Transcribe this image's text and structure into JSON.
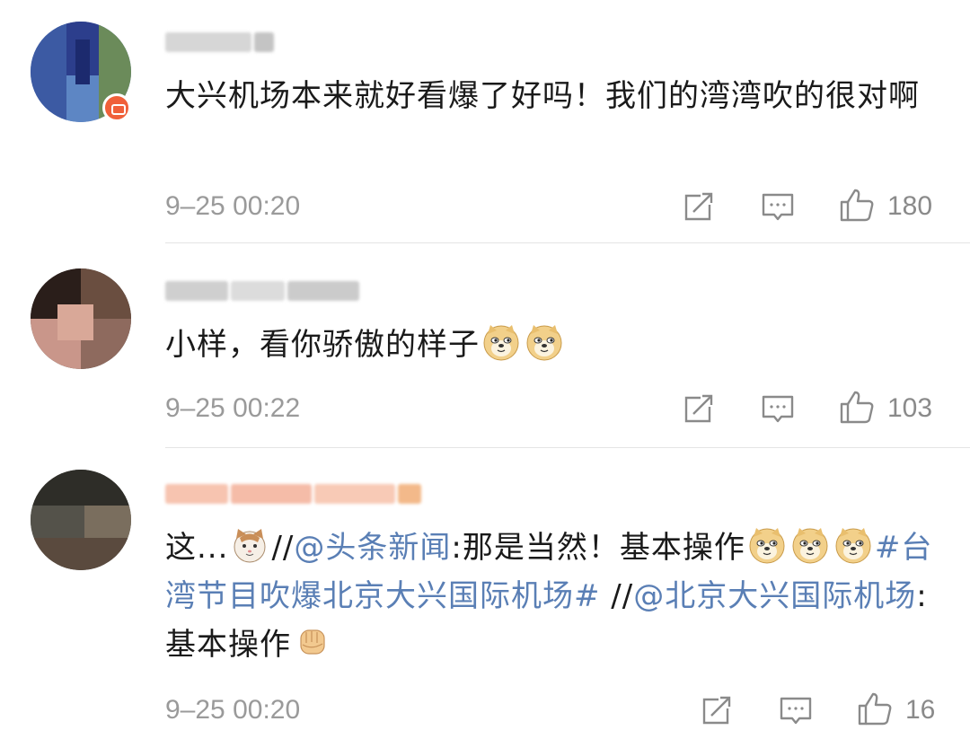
{
  "comments": [
    {
      "text": "大兴机场本来就好看爆了好吗！我们的湾湾吹的很对啊",
      "time": "9–25 00:20",
      "likes": "180"
    },
    {
      "text": "小样，看你骄傲的样子",
      "time": "9–25 00:22",
      "likes": "103"
    },
    {
      "text_parts": {
        "p1": "这...",
        "p2": "//",
        "mention1": "@头条新闻",
        "p3": ":那是当然！基本操作",
        "hashtag": "#台湾节目吹爆北京大兴国际机场#",
        "p4": " //",
        "mention2": "@北京大兴国际机场",
        "p5": ":基本操作"
      },
      "time": "9–25 00:20",
      "likes": "16"
    }
  ],
  "icons": {
    "repost": "repost-icon",
    "comment": "comment-icon",
    "like": "thumbs-up-icon",
    "emoji_doge": "doge-emoji",
    "emoji_cat": "cat-emoji",
    "emoji_fist": "fist-emoji",
    "vip_badge": "vip-badge-icon"
  },
  "colors": {
    "link": "#5a7fb5",
    "meta_text": "#9a9a9a",
    "divider": "#e4e4e4",
    "vip_badge": "#f0603a"
  }
}
